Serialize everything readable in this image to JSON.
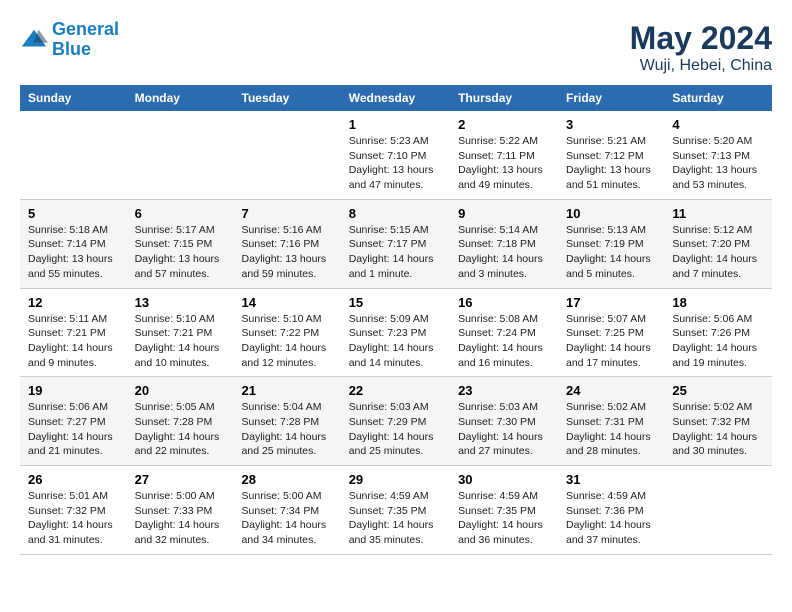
{
  "header": {
    "logo_line1": "General",
    "logo_line2": "Blue",
    "month": "May 2024",
    "location": "Wuji, Hebei, China"
  },
  "days_of_week": [
    "Sunday",
    "Monday",
    "Tuesday",
    "Wednesday",
    "Thursday",
    "Friday",
    "Saturday"
  ],
  "weeks": [
    [
      {
        "day": "",
        "info": ""
      },
      {
        "day": "",
        "info": ""
      },
      {
        "day": "",
        "info": ""
      },
      {
        "day": "1",
        "info": "Sunrise: 5:23 AM\nSunset: 7:10 PM\nDaylight: 13 hours\nand 47 minutes."
      },
      {
        "day": "2",
        "info": "Sunrise: 5:22 AM\nSunset: 7:11 PM\nDaylight: 13 hours\nand 49 minutes."
      },
      {
        "day": "3",
        "info": "Sunrise: 5:21 AM\nSunset: 7:12 PM\nDaylight: 13 hours\nand 51 minutes."
      },
      {
        "day": "4",
        "info": "Sunrise: 5:20 AM\nSunset: 7:13 PM\nDaylight: 13 hours\nand 53 minutes."
      }
    ],
    [
      {
        "day": "5",
        "info": "Sunrise: 5:18 AM\nSunset: 7:14 PM\nDaylight: 13 hours\nand 55 minutes."
      },
      {
        "day": "6",
        "info": "Sunrise: 5:17 AM\nSunset: 7:15 PM\nDaylight: 13 hours\nand 57 minutes."
      },
      {
        "day": "7",
        "info": "Sunrise: 5:16 AM\nSunset: 7:16 PM\nDaylight: 13 hours\nand 59 minutes."
      },
      {
        "day": "8",
        "info": "Sunrise: 5:15 AM\nSunset: 7:17 PM\nDaylight: 14 hours\nand 1 minute."
      },
      {
        "day": "9",
        "info": "Sunrise: 5:14 AM\nSunset: 7:18 PM\nDaylight: 14 hours\nand 3 minutes."
      },
      {
        "day": "10",
        "info": "Sunrise: 5:13 AM\nSunset: 7:19 PM\nDaylight: 14 hours\nand 5 minutes."
      },
      {
        "day": "11",
        "info": "Sunrise: 5:12 AM\nSunset: 7:20 PM\nDaylight: 14 hours\nand 7 minutes."
      }
    ],
    [
      {
        "day": "12",
        "info": "Sunrise: 5:11 AM\nSunset: 7:21 PM\nDaylight: 14 hours\nand 9 minutes."
      },
      {
        "day": "13",
        "info": "Sunrise: 5:10 AM\nSunset: 7:21 PM\nDaylight: 14 hours\nand 10 minutes."
      },
      {
        "day": "14",
        "info": "Sunrise: 5:10 AM\nSunset: 7:22 PM\nDaylight: 14 hours\nand 12 minutes."
      },
      {
        "day": "15",
        "info": "Sunrise: 5:09 AM\nSunset: 7:23 PM\nDaylight: 14 hours\nand 14 minutes."
      },
      {
        "day": "16",
        "info": "Sunrise: 5:08 AM\nSunset: 7:24 PM\nDaylight: 14 hours\nand 16 minutes."
      },
      {
        "day": "17",
        "info": "Sunrise: 5:07 AM\nSunset: 7:25 PM\nDaylight: 14 hours\nand 17 minutes."
      },
      {
        "day": "18",
        "info": "Sunrise: 5:06 AM\nSunset: 7:26 PM\nDaylight: 14 hours\nand 19 minutes."
      }
    ],
    [
      {
        "day": "19",
        "info": "Sunrise: 5:06 AM\nSunset: 7:27 PM\nDaylight: 14 hours\nand 21 minutes."
      },
      {
        "day": "20",
        "info": "Sunrise: 5:05 AM\nSunset: 7:28 PM\nDaylight: 14 hours\nand 22 minutes."
      },
      {
        "day": "21",
        "info": "Sunrise: 5:04 AM\nSunset: 7:28 PM\nDaylight: 14 hours\nand 25 minutes."
      },
      {
        "day": "22",
        "info": "Sunrise: 5:03 AM\nSunset: 7:29 PM\nDaylight: 14 hours\nand 25 minutes."
      },
      {
        "day": "23",
        "info": "Sunrise: 5:03 AM\nSunset: 7:30 PM\nDaylight: 14 hours\nand 27 minutes."
      },
      {
        "day": "24",
        "info": "Sunrise: 5:02 AM\nSunset: 7:31 PM\nDaylight: 14 hours\nand 28 minutes."
      },
      {
        "day": "25",
        "info": "Sunrise: 5:02 AM\nSunset: 7:32 PM\nDaylight: 14 hours\nand 30 minutes."
      }
    ],
    [
      {
        "day": "26",
        "info": "Sunrise: 5:01 AM\nSunset: 7:32 PM\nDaylight: 14 hours\nand 31 minutes."
      },
      {
        "day": "27",
        "info": "Sunrise: 5:00 AM\nSunset: 7:33 PM\nDaylight: 14 hours\nand 32 minutes."
      },
      {
        "day": "28",
        "info": "Sunrise: 5:00 AM\nSunset: 7:34 PM\nDaylight: 14 hours\nand 34 minutes."
      },
      {
        "day": "29",
        "info": "Sunrise: 4:59 AM\nSunset: 7:35 PM\nDaylight: 14 hours\nand 35 minutes."
      },
      {
        "day": "30",
        "info": "Sunrise: 4:59 AM\nSunset: 7:35 PM\nDaylight: 14 hours\nand 36 minutes."
      },
      {
        "day": "31",
        "info": "Sunrise: 4:59 AM\nSunset: 7:36 PM\nDaylight: 14 hours\nand 37 minutes."
      },
      {
        "day": "",
        "info": ""
      }
    ]
  ]
}
